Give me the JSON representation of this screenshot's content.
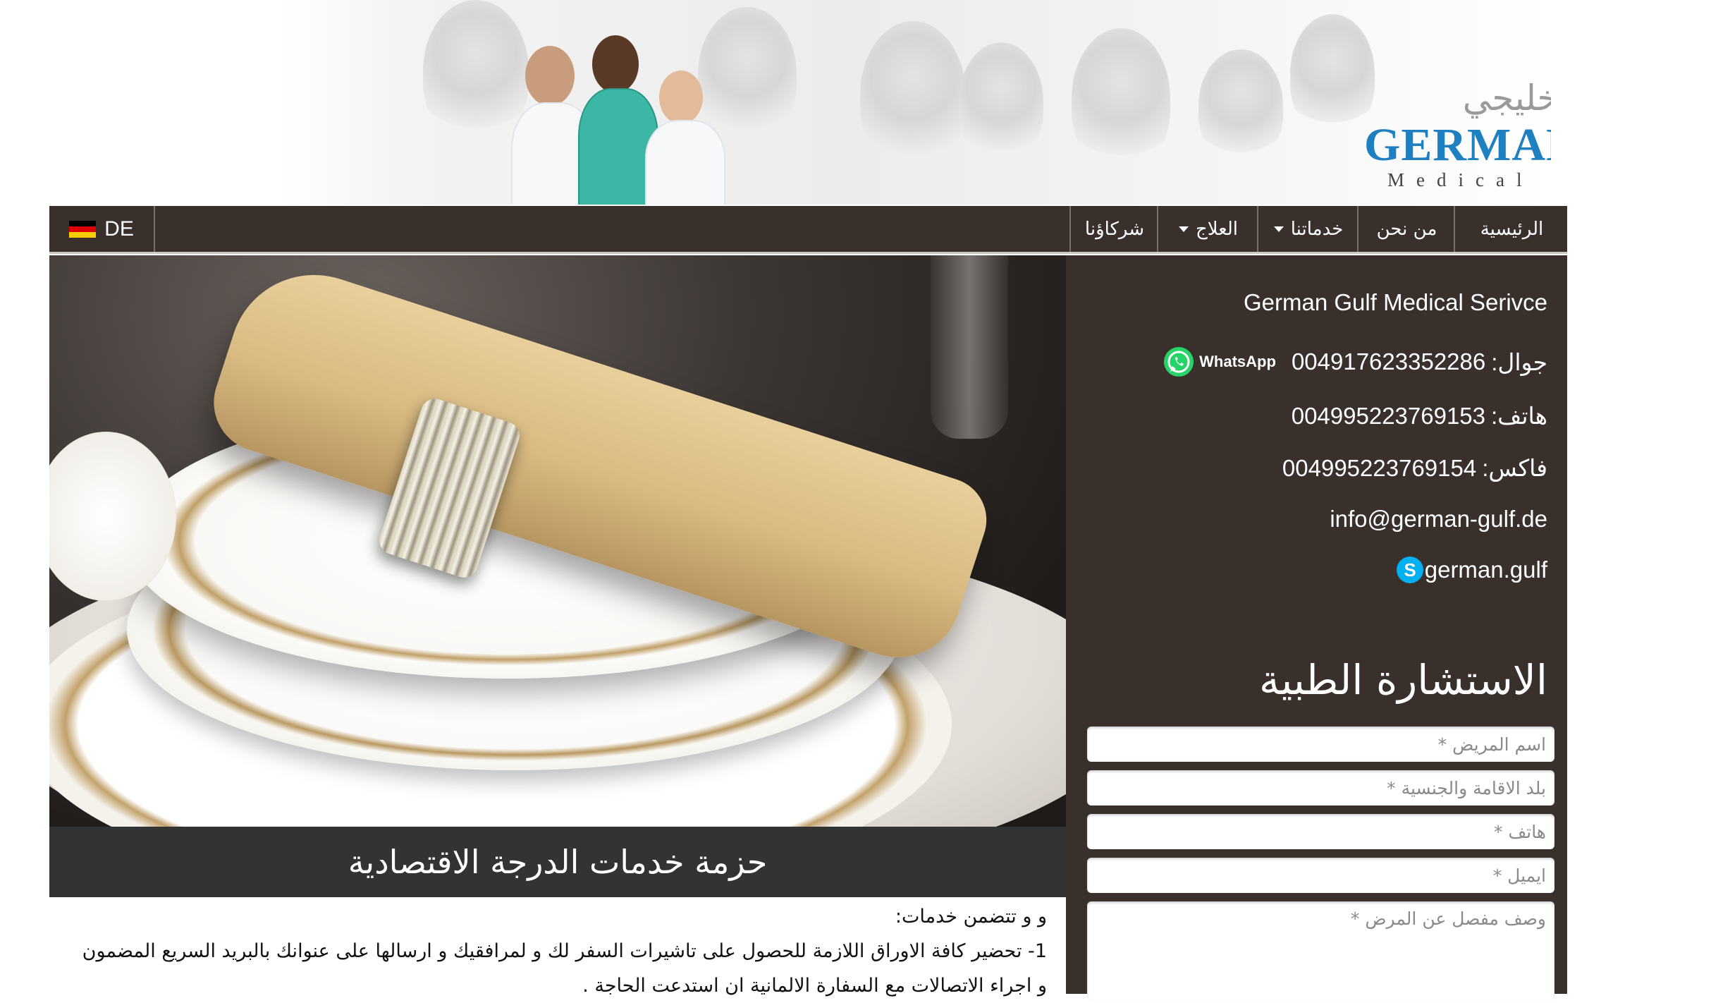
{
  "header": {
    "logo_arabic": "الألماني الخليجي",
    "logo_english": "GERMAN GULF",
    "logo_subtitle": "Medical Service",
    "logo_colors": {
      "primary_blue": "#1e7fc1",
      "green": "#2bae3f"
    }
  },
  "nav": {
    "items": [
      {
        "label": "الرئيسية",
        "dropdown": false
      },
      {
        "label": "من نحن",
        "dropdown": false
      },
      {
        "label": "خدماتنا",
        "dropdown": true
      },
      {
        "label": "العلاج",
        "dropdown": true
      },
      {
        "label": "شركاؤنا",
        "dropdown": false
      }
    ],
    "language": {
      "label": "DE",
      "icon": "germany-flag-icon"
    }
  },
  "hero": {
    "caption": "حزمة خدمات الدرجة الاقتصادية"
  },
  "description": {
    "lines": [
      "و و تتضمن خدمات:",
      "1- تحضير كافة الاوراق اللازمة للحصول على تاشيرات السفر لك و لمرافقيك و ارسالها على عنوانك بالبريد السريع المضمون",
      "و اجراء الاتصالات مع السفارة الالمانية ان استدعت الحاجة ."
    ]
  },
  "contact": {
    "company": "German Gulf Medical Serivce",
    "mobile_label": "جوال:",
    "mobile": "004917623352286",
    "whatsapp_label": "WhatsApp",
    "phone_label": "هاتف:",
    "phone": "004995223769153",
    "fax_label": "فاكس:",
    "fax": "004995223769154",
    "email": "info@german-gulf.de",
    "skype": "german.gulf"
  },
  "form": {
    "title": "الاستشارة الطبية",
    "patient_name_placeholder": "اسم المريض *",
    "country_placeholder": "بلد الاقامة والجنسية *",
    "phone_placeholder": "هاتف *",
    "email_placeholder": "ايميل *",
    "description_placeholder": "وصف مفصل عن المرض *"
  },
  "colors": {
    "nav_bg": "#3a302b",
    "caption_bg": "#333333",
    "whatsapp_green": "#25d366",
    "skype_blue": "#00aff0"
  }
}
